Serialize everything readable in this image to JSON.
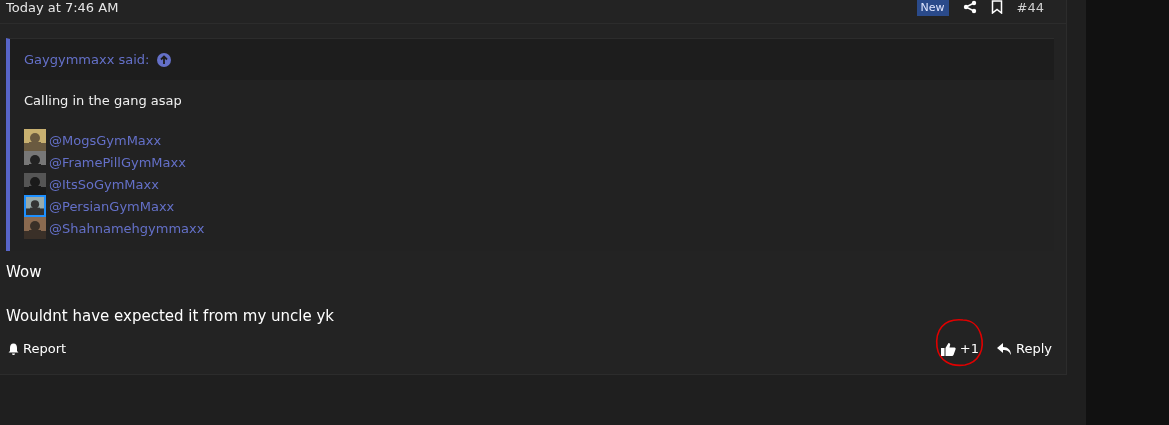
{
  "post_header": {
    "time": "Today at 7:46 AM",
    "badge": "New",
    "number": "#44"
  },
  "quote": {
    "author": "Gaygymmaxx said:",
    "text": "Calling in the gang asap",
    "mentions": [
      {
        "name": "@MogsGymMaxx",
        "highlighted": false
      },
      {
        "name": "@FramePillGymMaxx",
        "highlighted": false
      },
      {
        "name": "@ItsSoGymMaxx",
        "highlighted": false
      },
      {
        "name": "@PersianGymMaxx",
        "highlighted": true
      },
      {
        "name": "@Shahnamehgymmaxx",
        "highlighted": false
      }
    ]
  },
  "body": [
    "Wow",
    "Wouldnt have expected it from my uncle yk"
  ],
  "footer": {
    "report": "Report",
    "reaction": "+1",
    "reply": "Reply"
  }
}
